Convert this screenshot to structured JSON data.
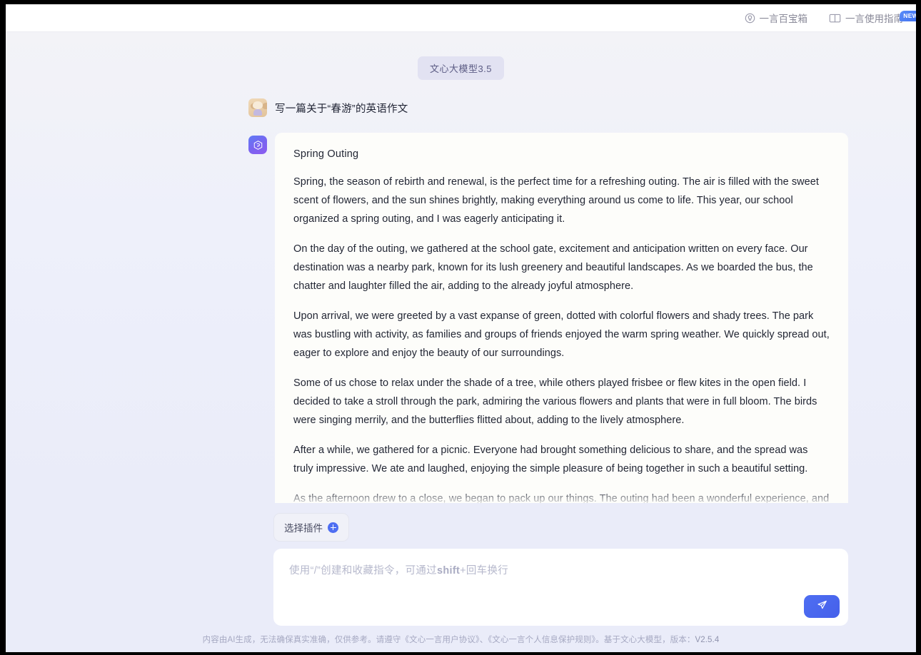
{
  "topbar": {
    "items": [
      {
        "label": "一言百宝箱",
        "icon": "lightbulb-icon"
      },
      {
        "label": "一言使用指南",
        "icon": "book-icon",
        "badge": "NEW"
      }
    ]
  },
  "conversation": {
    "model_pill": "文心大模型3.5",
    "user_message": "写一篇关于“春游”的英语作文",
    "response": {
      "title": "Spring Outing",
      "paragraphs": [
        "Spring, the season of rebirth and renewal, is the perfect time for a refreshing outing. The air is filled with the sweet scent of flowers, and the sun shines brightly, making everything around us come to life. This year, our school organized a spring outing, and I was eagerly anticipating it.",
        "On the day of the outing, we gathered at the school gate, excitement and anticipation written on every face. Our destination was a nearby park, known for its lush greenery and beautiful landscapes. As we boarded the bus, the chatter and laughter filled the air, adding to the already joyful atmosphere.",
        "Upon arrival, we were greeted by a vast expanse of green, dotted with colorful flowers and shady trees. The park was bustling with activity, as families and groups of friends enjoyed the warm spring weather. We quickly spread out, eager to explore and enjoy the beauty of our surroundings.",
        "Some of us chose to relax under the shade of a tree, while others played frisbee or flew kites in the open field. I decided to take a stroll through the park, admiring the various flowers and plants that were in full bloom. The birds were singing merrily, and the butterflies flitted about, adding to the lively atmosphere.",
        "After a while, we gathered for a picnic. Everyone had brought something delicious to share, and the spread was truly impressive. We ate and laughed, enjoying the simple pleasure of being together in such a beautiful setting.",
        "As the afternoon drew to a close, we began to pack up our things. The outing had been a wonderful experience, and I was already looking forward to the next one. As we boarded the bus back to school, I couldn't help but"
      ]
    }
  },
  "composer": {
    "plugin_label": "选择插件",
    "placeholder_prefix": "使用“/”创建和收藏指令，可通过",
    "placeholder_bold": "shift",
    "placeholder_suffix": "+回车换行",
    "send_icon": "paper-plane-icon"
  },
  "footer": {
    "disclaimer_1": "内容由AI生成，无法确保真实准确，仅供参考。请遵守",
    "link_1": "《文心一言用户协议》",
    "separator": "、",
    "link_2": "《文心一言个人信息保护规则》",
    "disclaimer_2": "。基于文心大模型，版本：",
    "version": "V2.5.4"
  },
  "colors": {
    "accent": "#4e6ef2",
    "page_bg": "#eaecf9",
    "card_bg": "#fdfdfa"
  }
}
